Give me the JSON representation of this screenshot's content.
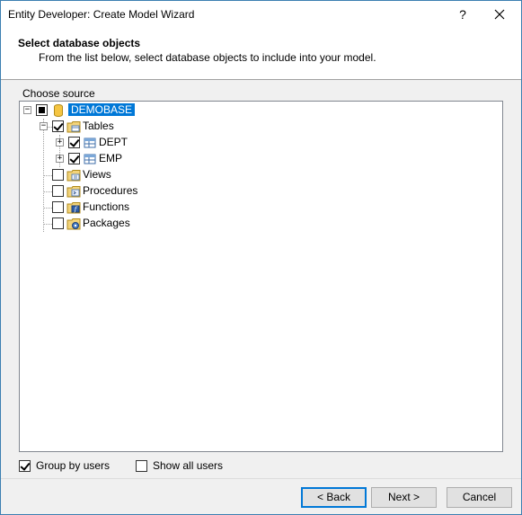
{
  "window": {
    "title": "Entity Developer: Create Model Wizard",
    "help_label": "?",
    "close_label": "✕"
  },
  "header": {
    "title": "Select database objects",
    "subtitle": "From the list below, select database objects to include into your model."
  },
  "choose_source_label": "Choose source",
  "tree": {
    "root": {
      "label": "DEMOBASE",
      "state": "partial",
      "expanded": true,
      "selected": true,
      "icon": "database-icon"
    },
    "tables": {
      "label": "Tables",
      "state": "checked",
      "expanded": true,
      "icon": "folder-tables-icon"
    },
    "dept": {
      "label": "DEPT",
      "state": "checked",
      "expanded": false,
      "icon": "table-icon"
    },
    "emp": {
      "label": "EMP",
      "state": "checked",
      "expanded": false,
      "icon": "table-icon"
    },
    "views": {
      "label": "Views",
      "state": "unchecked",
      "icon": "folder-views-icon"
    },
    "procedures": {
      "label": "Procedures",
      "state": "unchecked",
      "icon": "folder-procedures-icon"
    },
    "functions": {
      "label": "Functions",
      "state": "unchecked",
      "icon": "folder-functions-icon"
    },
    "packages": {
      "label": "Packages",
      "state": "unchecked",
      "icon": "folder-packages-icon"
    }
  },
  "options": {
    "group_by_users": {
      "label": "Group by users",
      "checked": true
    },
    "show_all_users": {
      "label": "Show all users",
      "checked": false
    }
  },
  "buttons": {
    "back": "< Back",
    "next": "Next >",
    "cancel": "Cancel"
  }
}
